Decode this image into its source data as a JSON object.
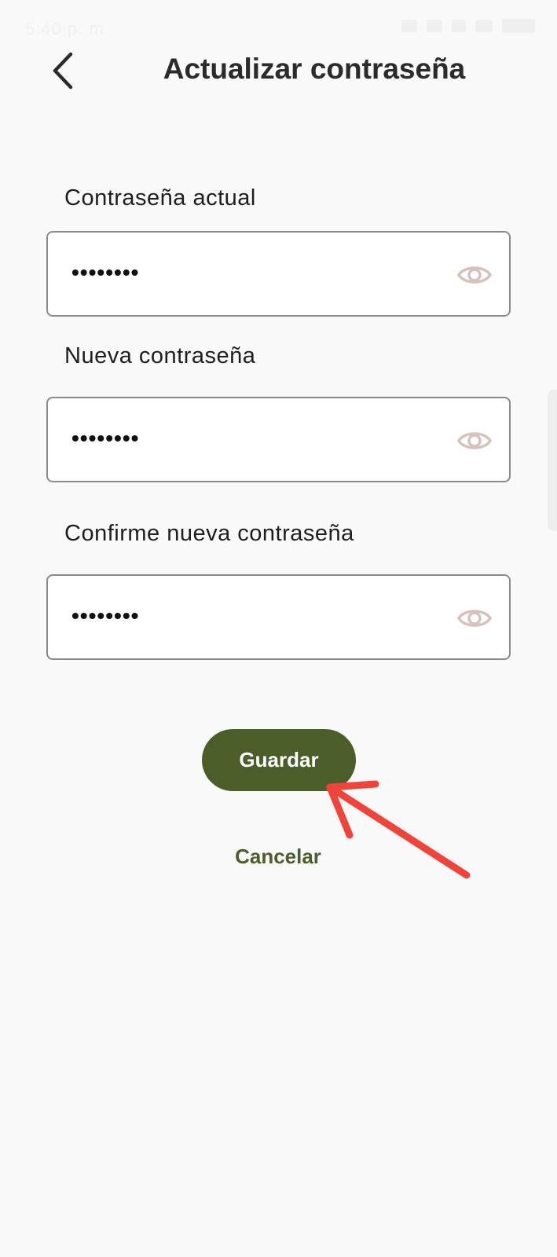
{
  "status_bar": {
    "time": "5:40 p. m."
  },
  "header": {
    "title": "Actualizar contraseña",
    "back_icon": "chevron-left-icon"
  },
  "form": {
    "current_password": {
      "label": "Contraseña actual",
      "value": "••••••••",
      "toggle_icon": "eye-icon"
    },
    "new_password": {
      "label": "Nueva contraseña",
      "value": "••••••••",
      "toggle_icon": "eye-icon"
    },
    "confirm_password": {
      "label": "Confirme nueva contraseña",
      "value": "••••••••",
      "toggle_icon": "eye-icon"
    }
  },
  "actions": {
    "save_label": "Guardar",
    "cancel_label": "Cancelar"
  },
  "colors": {
    "accent": "#4b5e2a",
    "eye_icon": "#d6c2bb",
    "annotation": "#f0443a",
    "background": "#f9f9f9"
  }
}
